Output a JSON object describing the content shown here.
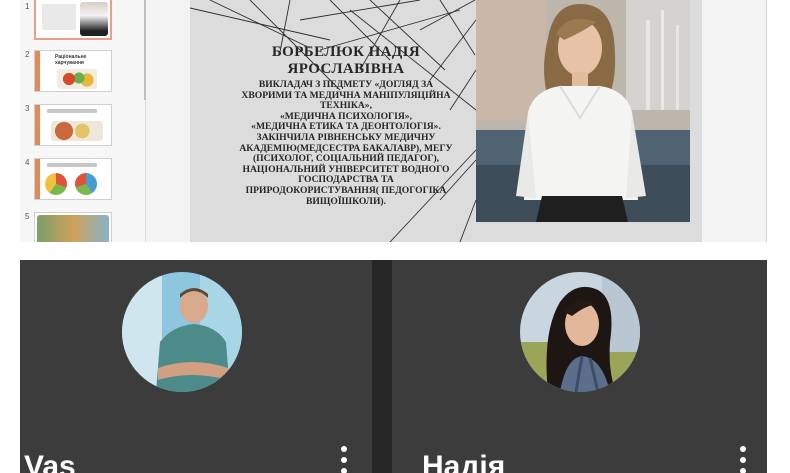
{
  "slide_panel": {
    "thumbnails": [
      {
        "number": "1",
        "title": ""
      },
      {
        "number": "2",
        "title": "Раціональне харчування"
      },
      {
        "number": "3",
        "title": ""
      },
      {
        "number": "4",
        "title": ""
      },
      {
        "number": "5",
        "title": ""
      }
    ]
  },
  "slide": {
    "name": "БОРБЕЛЮК НАДІЯ ЯРОСЛАВІВНА",
    "lines": [
      "ВИКЛАДАЧ З ПЕДМЕТУ «ДОГЛЯД ЗА",
      "ХВОРИМИ ТА МЕДИЧНА МАНІПУЛЯЦІЙНА",
      "ТЕХНІКА»,",
      "«МЕДИЧНА ПСИХОЛОГІЯ»,",
      "«МЕДИЧНА ЕТИКА ТА ДЕОНТОЛОГІЯ».",
      "ЗАКІНЧИЛА РІВНЕНСЬКУ МЕДИЧНУ",
      "АКАДЕМІЮ(МЕДСЕСТРА БАКАЛАВР), МЕГУ",
      "(ПСИХОЛОГ, СОЦІАЛЬНИЙ ПЕДАГОГ),",
      "НАЦІОНАЛЬНИЙ УНІВЕРСИТЕТ ВОДНОГО",
      "ГОСПОДАРСТВА ТА",
      "ПРИРОДОКОРИСТУВАННЯ( ПЕДОГОГІКА",
      "ВИЩОЇШКОЛИ)."
    ]
  },
  "participants": [
    {
      "name": "Vas",
      "menu_icon": "more-vert-icon"
    },
    {
      "name": "Надія",
      "menu_icon": "more-vert-icon"
    }
  ],
  "colors": {
    "tile_bg": "#3c3c3c",
    "divider": "#262626",
    "active_thumb_border": "#e7a08a"
  }
}
